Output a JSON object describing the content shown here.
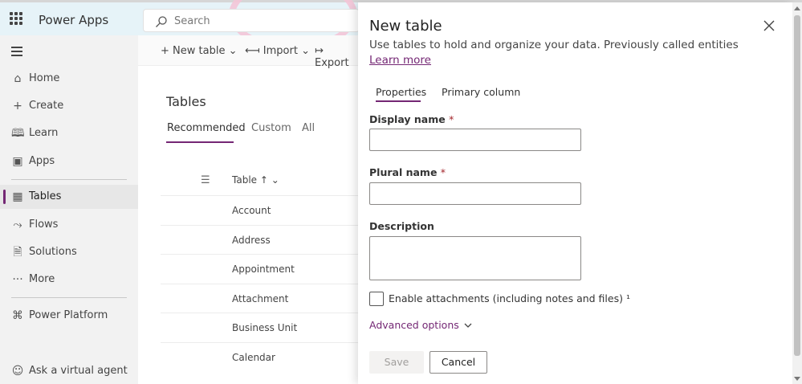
{
  "app": {
    "brand": "Power Apps",
    "search_placeholder": "Search"
  },
  "nav": {
    "items": [
      {
        "icon": "home-icon",
        "label": "Home"
      },
      {
        "icon": "plus-icon",
        "label": "Create"
      },
      {
        "icon": "book-icon",
        "label": "Learn"
      },
      {
        "icon": "apps-icon",
        "label": "Apps"
      },
      {
        "icon": "table-icon",
        "label": "Tables",
        "active": true
      },
      {
        "icon": "flows-icon",
        "label": "Flows"
      },
      {
        "icon": "solutions-icon",
        "label": "Solutions"
      },
      {
        "icon": "more-icon",
        "label": "More"
      },
      {
        "icon": "power-platform-icon",
        "label": "Power Platform"
      },
      {
        "icon": "virtual-agent-icon",
        "label": "Ask a virtual agent"
      }
    ]
  },
  "commands": {
    "new_table": "New table",
    "import": "Import",
    "export": "Export"
  },
  "main": {
    "title": "Tables",
    "tabs": [
      "Recommended",
      "Custom",
      "All"
    ],
    "column_header": "Table",
    "rows": [
      "Account",
      "Address",
      "Appointment",
      "Attachment",
      "Business Unit",
      "Calendar"
    ]
  },
  "panel": {
    "title": "New table",
    "subtitle": "Use tables to hold and organize your data. Previously called entities",
    "learn_more": "Learn more",
    "tabs": {
      "properties": "Properties",
      "primary_column": "Primary column"
    },
    "display_name_label": "Display name",
    "plural_name_label": "Plural name",
    "description_label": "Description",
    "required_mark": "*",
    "attachments_label": "Enable attachments (including notes and files) ¹",
    "advanced_options": "Advanced options",
    "save": "Save",
    "cancel": "Cancel"
  },
  "colors": {
    "accent": "#742774",
    "topbar": "#e6f3f8",
    "nav_bg": "#f2f2f2"
  }
}
